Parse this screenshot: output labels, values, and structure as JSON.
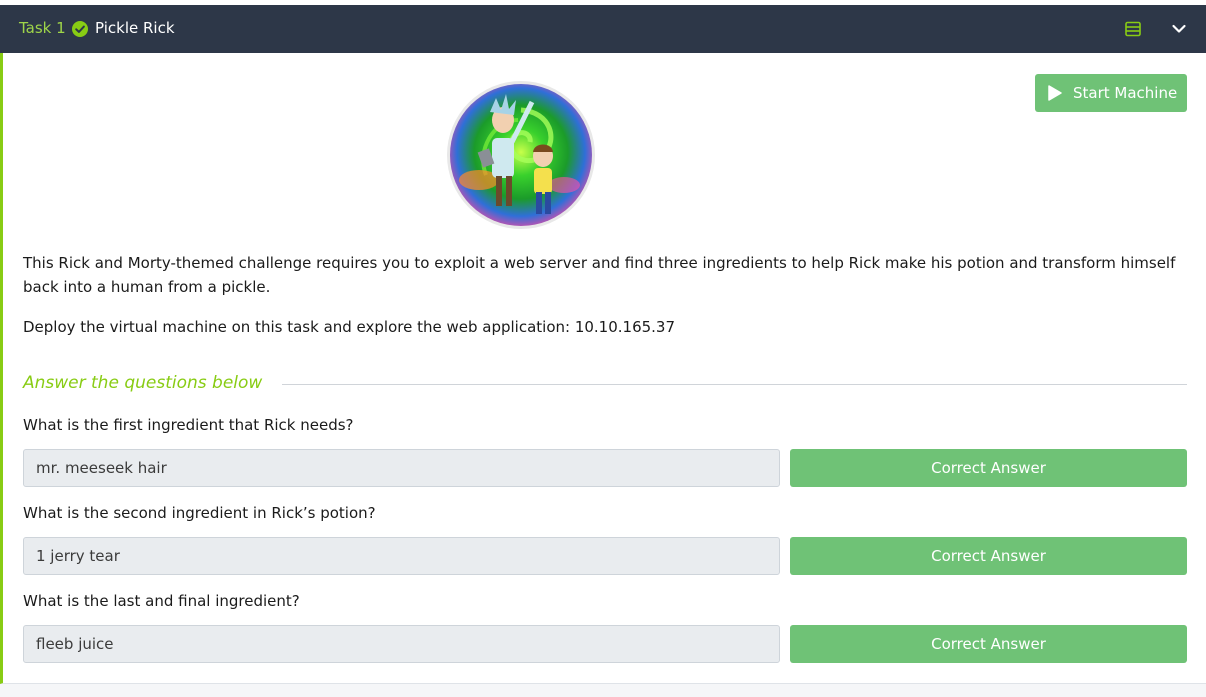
{
  "task": {
    "label": "Task 1",
    "title": "Pickle Rick",
    "status_color": "#88cc14"
  },
  "start_machine": {
    "label": "Start Machine"
  },
  "image": {
    "alt": "Rick and Morty portal"
  },
  "description": {
    "paragraph1": "This Rick and Morty-themed challenge requires you to exploit a web server and find three ingredients to help Rick make his potion and transform himself back into a human from a pickle.",
    "paragraph2": "Deploy the virtual machine on this task and explore the web application: 10.10.165.37"
  },
  "questions_section": {
    "title": "Answer the questions below"
  },
  "questions": [
    {
      "question": "What is the first ingredient that Rick needs?",
      "answer": "mr. meeseek hair",
      "button": "Correct Answer"
    },
    {
      "question": "What is the second ingredient in Rick’s potion?",
      "answer": "1 jerry tear",
      "button": "Correct Answer"
    },
    {
      "question": "What is the last and final ingredient?",
      "answer": "fleeb juice",
      "button": "Correct Answer"
    }
  ],
  "icons": {
    "check": "check-circle-icon",
    "list": "list-icon",
    "chevron": "chevron-down-icon",
    "play": "play-icon"
  },
  "colors": {
    "header_bg": "#2d3748",
    "accent": "#88cc14",
    "button_green": "#6fc276"
  }
}
